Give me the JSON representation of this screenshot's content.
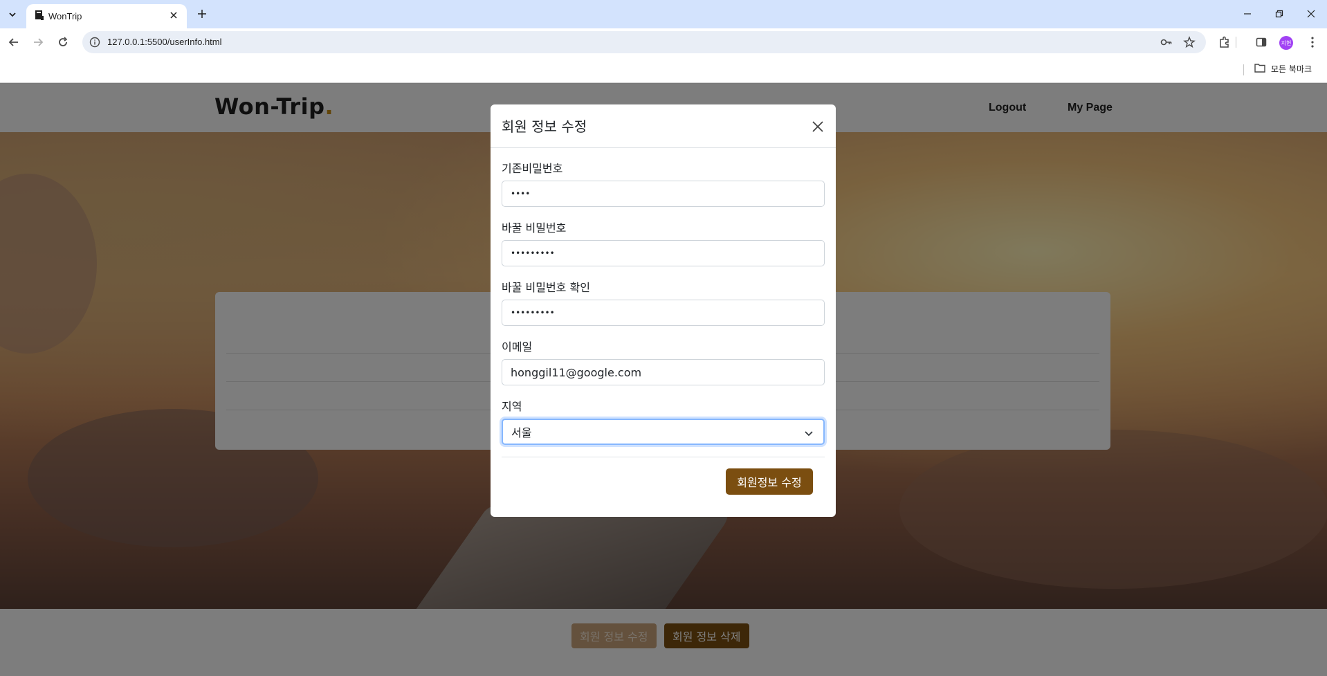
{
  "browser": {
    "tab_title": "WonTrip",
    "url": "127.0.0.1:5500/userInfo.html",
    "bookmarks_folder": "모든 북마크",
    "profile_initials": "지헌"
  },
  "site": {
    "logo": "Won-Trip",
    "logo_dot": ".",
    "nav": [
      "Logout",
      "My Page"
    ]
  },
  "footer_buttons": {
    "edit": "회원 정보 수정",
    "delete": "회원 정보 삭제"
  },
  "modal": {
    "title": "회원 정보 수정",
    "fields": {
      "current_password": {
        "label": "기존비밀번호",
        "value": "••••"
      },
      "new_password": {
        "label": "바꿀 비밀번호",
        "value": "•••••••••"
      },
      "confirm_password": {
        "label": "바꿀 비밀번호 확인",
        "value": "•••••••••"
      },
      "email": {
        "label": "이메일",
        "value": "honggil11@google.com"
      },
      "region": {
        "label": "지역",
        "value": "서울"
      }
    },
    "submit": "회원정보 수정"
  },
  "colors": {
    "brand_brown": "#7b4e10",
    "logo_dot": "#c58a12",
    "focus_ring": "#86b7fe"
  }
}
